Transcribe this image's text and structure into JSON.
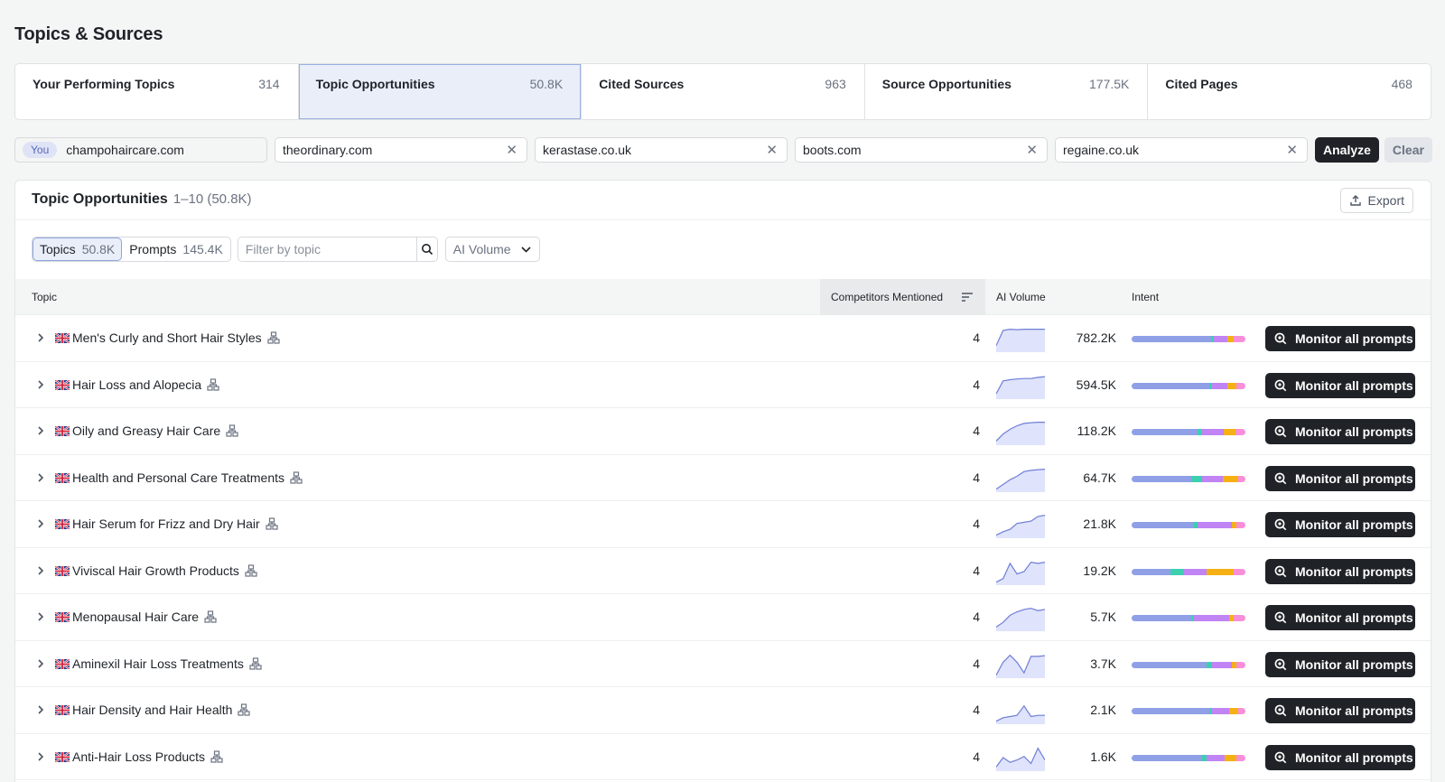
{
  "page": {
    "title": "Topics & Sources"
  },
  "tabs": [
    {
      "label": "Your Performing Topics",
      "count": "314"
    },
    {
      "label": "Topic Opportunities",
      "count": "50.8K"
    },
    {
      "label": "Cited Sources",
      "count": "963"
    },
    {
      "label": "Source Opportunities",
      "count": "177.5K"
    },
    {
      "label": "Cited Pages",
      "count": "468"
    }
  ],
  "domains": {
    "you_badge": "You",
    "you": "champohaircare.com",
    "competitors": [
      "theordinary.com",
      "kerastase.co.uk",
      "boots.com",
      "regaine.co.uk"
    ],
    "analyze_label": "Analyze",
    "clear_label": "Clear"
  },
  "panel": {
    "title": "Topic Opportunities",
    "range": "1–10 (50.8K)",
    "export_label": "Export",
    "segments": [
      {
        "label": "Topics",
        "count": "50.8K"
      },
      {
        "label": "Prompts",
        "count": "145.4K"
      }
    ],
    "filter_placeholder": "Filter by topic",
    "select_value": "AI Volume"
  },
  "table": {
    "headers": {
      "topic": "Topic",
      "competitors": "Competitors Mentioned",
      "volume": "AI Volume",
      "intent": "Intent"
    },
    "action_label": "Monitor all prompts",
    "intent_colors": [
      "#8fa0e6",
      "#3ccfb0",
      "#c084f5",
      "#f5b014",
      "#f78fd8"
    ],
    "rows": [
      {
        "topic": "Men's Curly and Short Hair Styles",
        "competitors": "4",
        "volume": "782.2K",
        "spark": [
          0.2,
          0.85,
          0.9,
          0.88,
          0.9,
          0.9,
          0.9,
          0.9
        ],
        "intent": [
          70,
          2,
          12,
          6,
          10
        ]
      },
      {
        "topic": "Hair Loss and Alopecia",
        "competitors": "4",
        "volume": "594.5K",
        "spark": [
          0.15,
          0.7,
          0.75,
          0.78,
          0.8,
          0.8,
          0.85,
          0.88
        ],
        "intent": [
          68,
          2,
          14,
          8,
          8
        ]
      },
      {
        "topic": "Oily and Greasy Hair Care",
        "competitors": "4",
        "volume": "118.2K",
        "spark": [
          0.1,
          0.4,
          0.6,
          0.75,
          0.85,
          0.88,
          0.9,
          0.9
        ],
        "intent": [
          58,
          3,
          20,
          10,
          9
        ]
      },
      {
        "topic": "Health and Personal Care Treatments",
        "competitors": "4",
        "volume": "64.7K",
        "spark": [
          0.05,
          0.25,
          0.45,
          0.6,
          0.8,
          0.85,
          0.88,
          0.9
        ],
        "intent": [
          52,
          10,
          18,
          14,
          6
        ]
      },
      {
        "topic": "Hair Serum for Frizz and Dry Hair",
        "competitors": "4",
        "volume": "21.8K",
        "spark": [
          0.05,
          0.2,
          0.3,
          0.55,
          0.6,
          0.65,
          0.85,
          0.9
        ],
        "intent": [
          54,
          4,
          30,
          4,
          8
        ]
      },
      {
        "topic": "Viviscal Hair Growth Products",
        "competitors": "4",
        "volume": "19.2K",
        "spark": [
          0.05,
          0.2,
          0.85,
          0.4,
          0.5,
          0.9,
          0.85,
          0.9
        ],
        "intent": [
          34,
          12,
          20,
          24,
          10
        ]
      },
      {
        "topic": "Menopausal Hair Care",
        "competitors": "4",
        "volume": "5.7K",
        "spark": [
          0.1,
          0.3,
          0.6,
          0.75,
          0.85,
          0.9,
          0.8,
          0.85
        ],
        "intent": [
          52,
          2,
          32,
          4,
          10
        ]
      },
      {
        "topic": "Aminexil Hair Loss Treatments",
        "competitors": "4",
        "volume": "3.7K",
        "spark": [
          0.05,
          0.6,
          0.9,
          0.6,
          0.15,
          0.85,
          0.85,
          0.88
        ],
        "intent": [
          66,
          4,
          18,
          4,
          8
        ]
      },
      {
        "topic": "Hair Density and Hair Health",
        "competitors": "4",
        "volume": "2.1K",
        "spark": [
          0.05,
          0.2,
          0.25,
          0.3,
          0.7,
          0.25,
          0.3,
          0.3
        ],
        "intent": [
          68,
          2,
          16,
          8,
          6
        ]
      },
      {
        "topic": "Anti-Hair Loss Products",
        "competitors": "4",
        "volume": "1.6K",
        "spark": [
          0.1,
          0.5,
          0.3,
          0.4,
          0.55,
          0.25,
          0.9,
          0.4
        ],
        "intent": [
          62,
          4,
          16,
          10,
          8
        ]
      }
    ]
  }
}
